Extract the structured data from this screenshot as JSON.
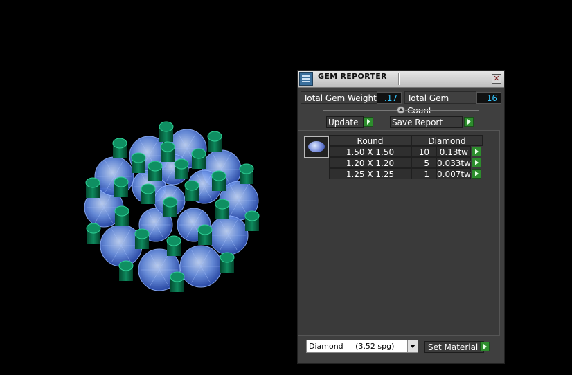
{
  "panel": {
    "title": "GEM REPORTER",
    "close_symbol": "✕",
    "total_weight_label": "Total Gem Weight",
    "total_weight_value": ".17",
    "total_count_label": "Total Gem Count",
    "total_count_value": "16",
    "update_label": "Update",
    "save_report_label": "Save Report",
    "set_material_label": "Set Material",
    "material_selected": "Diamond     (3.52 spg)"
  },
  "report_table": {
    "headers": [
      "Round",
      "Diamond"
    ],
    "rows": [
      {
        "size": "1.50 X 1.50",
        "count": "10",
        "weight": "0.13tw"
      },
      {
        "size": "1.20 X 1.20",
        "count": "5",
        "weight": "0.033tw"
      },
      {
        "size": "1.25 X 1.25",
        "count": "1",
        "weight": "0.007tw"
      }
    ]
  },
  "icons": {
    "title_icon": "report-icon",
    "close_icon": "close-icon",
    "arrow_icon": "green-play-arrow-icon",
    "gem_thumbnail": "round-gem-icon",
    "dropdown_icon": "chevron-down-icon"
  },
  "colors": {
    "value_text": "#34c6ff",
    "gem_blue": "#5b86e0",
    "prong_green": "#0d7a55"
  }
}
